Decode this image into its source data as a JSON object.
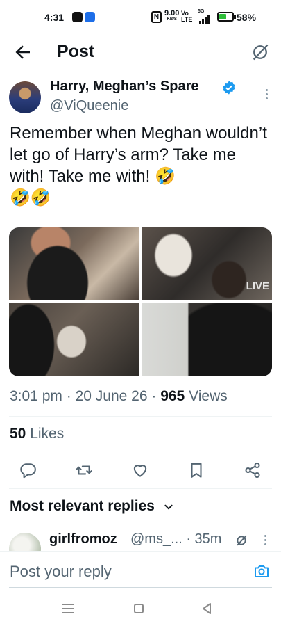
{
  "status_bar": {
    "time": "4:31",
    "speed": "9.00",
    "speed_unit": "KB/S",
    "volte_top": "Vo",
    "volte_bottom": "LTE",
    "network": "5G",
    "battery_percent": "58%",
    "battery_level": 0.58
  },
  "header": {
    "title": "Post",
    "back_icon": "arrow-left-icon",
    "grok_icon": "grok-icon"
  },
  "post": {
    "author_name": "Harry, Meghan’s Spare",
    "handle": "@ViQueenie",
    "verified": true,
    "text": "Remember when Meghan wouldn’t let go of Harry’s arm? Take me with! Take me with! 🤣\n🤣🤣",
    "media_overlay_text": "LIVE",
    "time": "3:01 pm",
    "date": "20 June 26",
    "views_count": "965",
    "views_label": "Views",
    "separator": "·",
    "likes_count": "50",
    "likes_label": "Likes"
  },
  "actions": [
    {
      "name": "reply-icon"
    },
    {
      "name": "repost-icon"
    },
    {
      "name": "like-icon"
    },
    {
      "name": "bookmark-icon"
    },
    {
      "name": "share-icon"
    }
  ],
  "replies": {
    "title": "Most relevant replies",
    "first_reply": {
      "name": "girlfromoz",
      "handle": "@ms_...",
      "time": "· 35m"
    }
  },
  "compose": {
    "placeholder": "Post your reply",
    "camera_icon": "camera-icon"
  },
  "colors": {
    "accent": "#1d9bf0",
    "text": "#0f1419",
    "secondary": "#536471",
    "border": "#eff3f4"
  }
}
